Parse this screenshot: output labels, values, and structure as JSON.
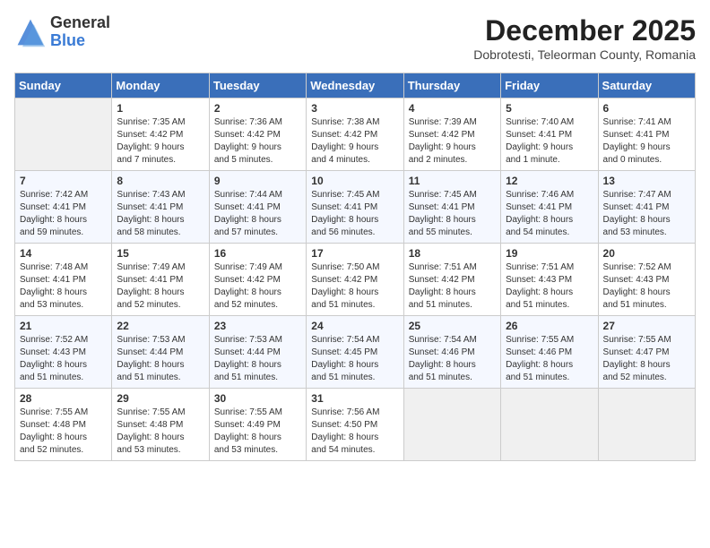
{
  "logo": {
    "general": "General",
    "blue": "Blue"
  },
  "title": "December 2025",
  "subtitle": "Dobrotesti, Teleorman County, Romania",
  "days": [
    "Sunday",
    "Monday",
    "Tuesday",
    "Wednesday",
    "Thursday",
    "Friday",
    "Saturday"
  ],
  "weeks": [
    [
      {
        "num": "",
        "empty": true
      },
      {
        "num": "1",
        "line1": "Sunrise: 7:35 AM",
        "line2": "Sunset: 4:42 PM",
        "line3": "Daylight: 9 hours",
        "line4": "and 7 minutes."
      },
      {
        "num": "2",
        "line1": "Sunrise: 7:36 AM",
        "line2": "Sunset: 4:42 PM",
        "line3": "Daylight: 9 hours",
        "line4": "and 5 minutes."
      },
      {
        "num": "3",
        "line1": "Sunrise: 7:38 AM",
        "line2": "Sunset: 4:42 PM",
        "line3": "Daylight: 9 hours",
        "line4": "and 4 minutes."
      },
      {
        "num": "4",
        "line1": "Sunrise: 7:39 AM",
        "line2": "Sunset: 4:42 PM",
        "line3": "Daylight: 9 hours",
        "line4": "and 2 minutes."
      },
      {
        "num": "5",
        "line1": "Sunrise: 7:40 AM",
        "line2": "Sunset: 4:41 PM",
        "line3": "Daylight: 9 hours",
        "line4": "and 1 minute."
      },
      {
        "num": "6",
        "line1": "Sunrise: 7:41 AM",
        "line2": "Sunset: 4:41 PM",
        "line3": "Daylight: 9 hours",
        "line4": "and 0 minutes."
      }
    ],
    [
      {
        "num": "7",
        "line1": "Sunrise: 7:42 AM",
        "line2": "Sunset: 4:41 PM",
        "line3": "Daylight: 8 hours",
        "line4": "and 59 minutes."
      },
      {
        "num": "8",
        "line1": "Sunrise: 7:43 AM",
        "line2": "Sunset: 4:41 PM",
        "line3": "Daylight: 8 hours",
        "line4": "and 58 minutes."
      },
      {
        "num": "9",
        "line1": "Sunrise: 7:44 AM",
        "line2": "Sunset: 4:41 PM",
        "line3": "Daylight: 8 hours",
        "line4": "and 57 minutes."
      },
      {
        "num": "10",
        "line1": "Sunrise: 7:45 AM",
        "line2": "Sunset: 4:41 PM",
        "line3": "Daylight: 8 hours",
        "line4": "and 56 minutes."
      },
      {
        "num": "11",
        "line1": "Sunrise: 7:45 AM",
        "line2": "Sunset: 4:41 PM",
        "line3": "Daylight: 8 hours",
        "line4": "and 55 minutes."
      },
      {
        "num": "12",
        "line1": "Sunrise: 7:46 AM",
        "line2": "Sunset: 4:41 PM",
        "line3": "Daylight: 8 hours",
        "line4": "and 54 minutes."
      },
      {
        "num": "13",
        "line1": "Sunrise: 7:47 AM",
        "line2": "Sunset: 4:41 PM",
        "line3": "Daylight: 8 hours",
        "line4": "and 53 minutes."
      }
    ],
    [
      {
        "num": "14",
        "line1": "Sunrise: 7:48 AM",
        "line2": "Sunset: 4:41 PM",
        "line3": "Daylight: 8 hours",
        "line4": "and 53 minutes."
      },
      {
        "num": "15",
        "line1": "Sunrise: 7:49 AM",
        "line2": "Sunset: 4:41 PM",
        "line3": "Daylight: 8 hours",
        "line4": "and 52 minutes."
      },
      {
        "num": "16",
        "line1": "Sunrise: 7:49 AM",
        "line2": "Sunset: 4:42 PM",
        "line3": "Daylight: 8 hours",
        "line4": "and 52 minutes."
      },
      {
        "num": "17",
        "line1": "Sunrise: 7:50 AM",
        "line2": "Sunset: 4:42 PM",
        "line3": "Daylight: 8 hours",
        "line4": "and 51 minutes."
      },
      {
        "num": "18",
        "line1": "Sunrise: 7:51 AM",
        "line2": "Sunset: 4:42 PM",
        "line3": "Daylight: 8 hours",
        "line4": "and 51 minutes."
      },
      {
        "num": "19",
        "line1": "Sunrise: 7:51 AM",
        "line2": "Sunset: 4:43 PM",
        "line3": "Daylight: 8 hours",
        "line4": "and 51 minutes."
      },
      {
        "num": "20",
        "line1": "Sunrise: 7:52 AM",
        "line2": "Sunset: 4:43 PM",
        "line3": "Daylight: 8 hours",
        "line4": "and 51 minutes."
      }
    ],
    [
      {
        "num": "21",
        "line1": "Sunrise: 7:52 AM",
        "line2": "Sunset: 4:43 PM",
        "line3": "Daylight: 8 hours",
        "line4": "and 51 minutes."
      },
      {
        "num": "22",
        "line1": "Sunrise: 7:53 AM",
        "line2": "Sunset: 4:44 PM",
        "line3": "Daylight: 8 hours",
        "line4": "and 51 minutes."
      },
      {
        "num": "23",
        "line1": "Sunrise: 7:53 AM",
        "line2": "Sunset: 4:44 PM",
        "line3": "Daylight: 8 hours",
        "line4": "and 51 minutes."
      },
      {
        "num": "24",
        "line1": "Sunrise: 7:54 AM",
        "line2": "Sunset: 4:45 PM",
        "line3": "Daylight: 8 hours",
        "line4": "and 51 minutes."
      },
      {
        "num": "25",
        "line1": "Sunrise: 7:54 AM",
        "line2": "Sunset: 4:46 PM",
        "line3": "Daylight: 8 hours",
        "line4": "and 51 minutes."
      },
      {
        "num": "26",
        "line1": "Sunrise: 7:55 AM",
        "line2": "Sunset: 4:46 PM",
        "line3": "Daylight: 8 hours",
        "line4": "and 51 minutes."
      },
      {
        "num": "27",
        "line1": "Sunrise: 7:55 AM",
        "line2": "Sunset: 4:47 PM",
        "line3": "Daylight: 8 hours",
        "line4": "and 52 minutes."
      }
    ],
    [
      {
        "num": "28",
        "line1": "Sunrise: 7:55 AM",
        "line2": "Sunset: 4:48 PM",
        "line3": "Daylight: 8 hours",
        "line4": "and 52 minutes."
      },
      {
        "num": "29",
        "line1": "Sunrise: 7:55 AM",
        "line2": "Sunset: 4:48 PM",
        "line3": "Daylight: 8 hours",
        "line4": "and 53 minutes."
      },
      {
        "num": "30",
        "line1": "Sunrise: 7:55 AM",
        "line2": "Sunset: 4:49 PM",
        "line3": "Daylight: 8 hours",
        "line4": "and 53 minutes."
      },
      {
        "num": "31",
        "line1": "Sunrise: 7:56 AM",
        "line2": "Sunset: 4:50 PM",
        "line3": "Daylight: 8 hours",
        "line4": "and 54 minutes."
      },
      {
        "num": "",
        "empty": true
      },
      {
        "num": "",
        "empty": true
      },
      {
        "num": "",
        "empty": true
      }
    ]
  ]
}
